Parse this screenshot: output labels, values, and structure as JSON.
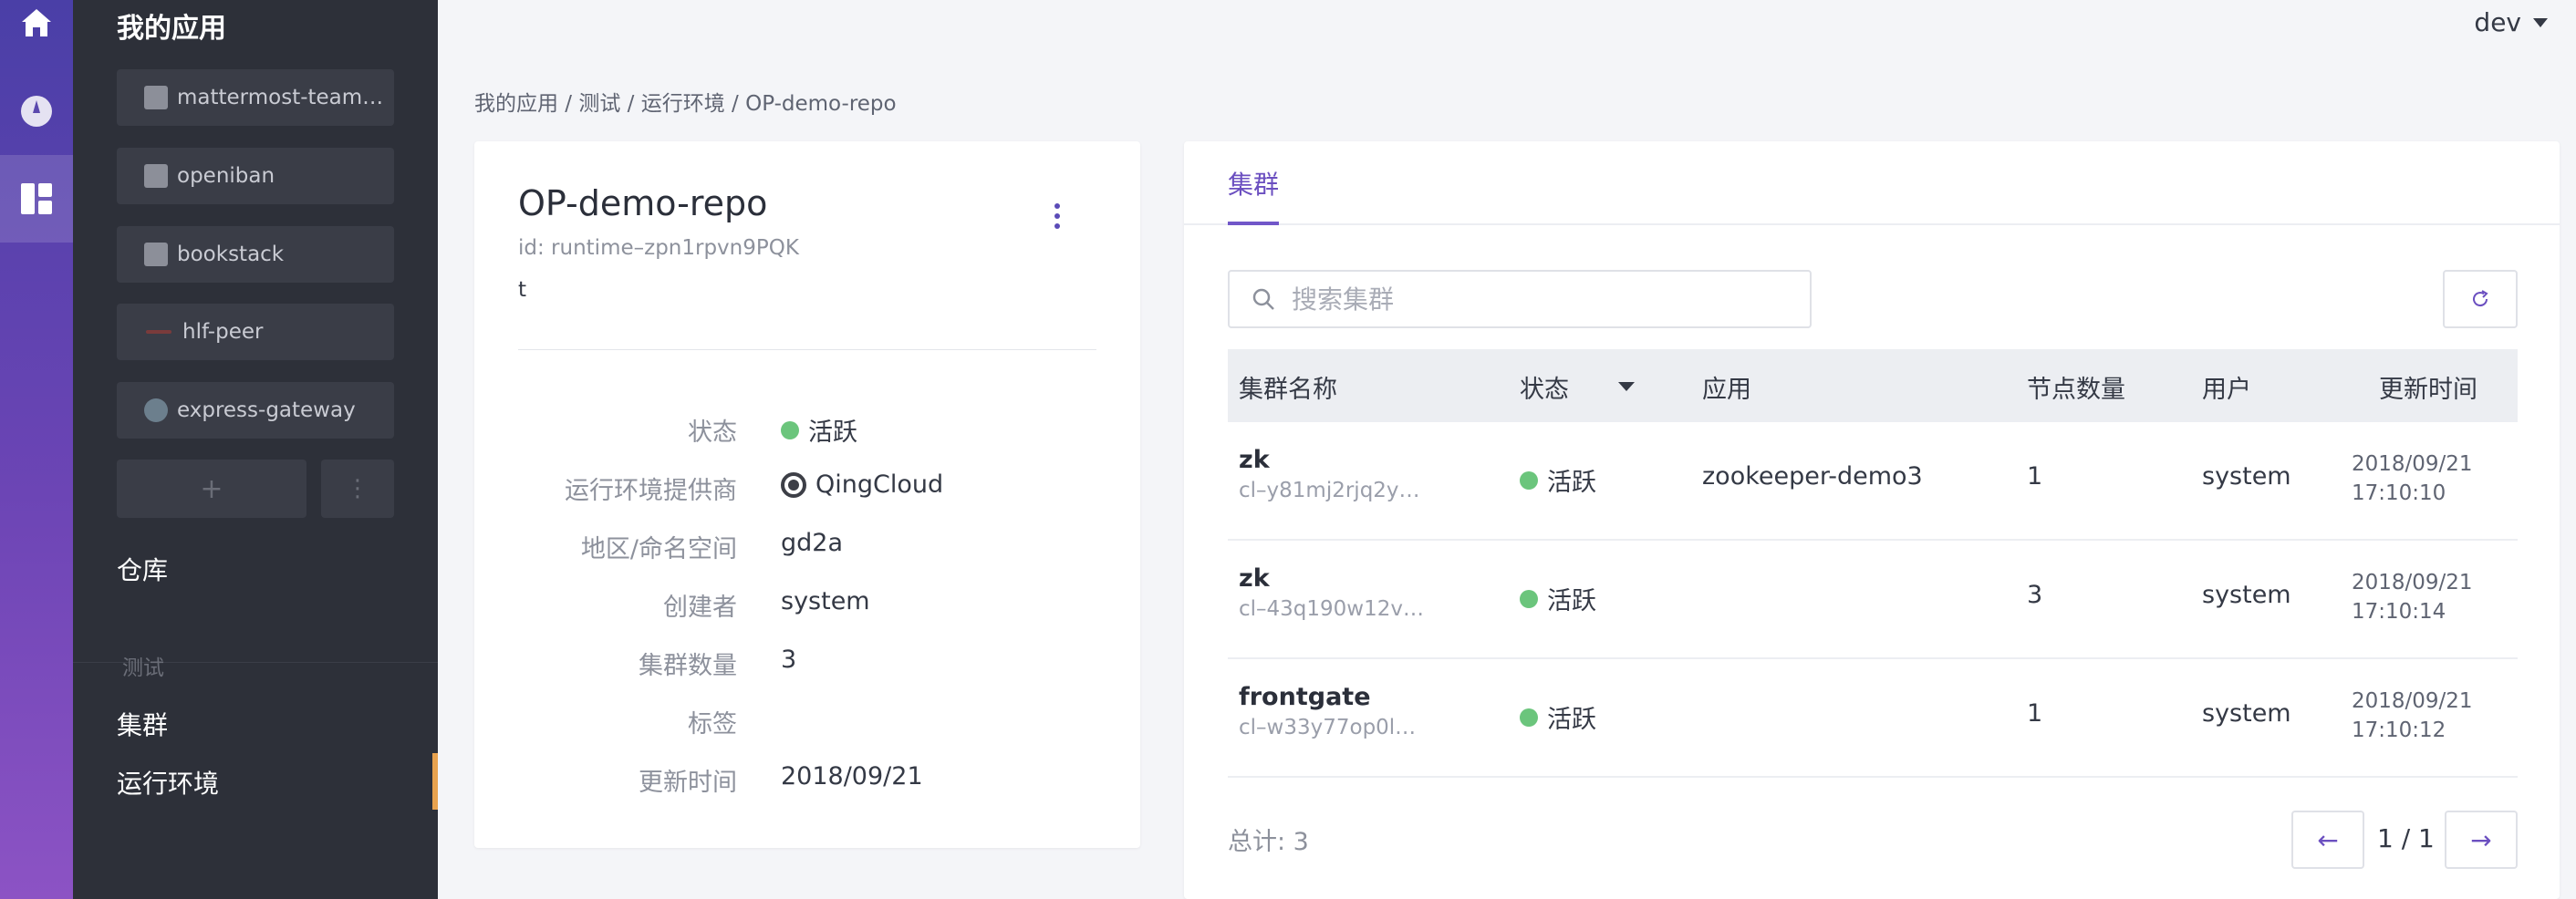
{
  "rail": {
    "items": [
      {
        "icon": "home-icon"
      },
      {
        "icon": "compass-icon"
      },
      {
        "icon": "dashboard-icon",
        "active": true
      }
    ]
  },
  "sidebar": {
    "title": "我的应用",
    "apps": [
      {
        "label": "mattermost-team…",
        "icon": "app-icon"
      },
      {
        "label": "openiban",
        "icon": "app-icon"
      },
      {
        "label": "bookstack",
        "icon": "app-icon"
      },
      {
        "label": "hlf-peer",
        "icon": "peer-icon"
      },
      {
        "label": "express-gateway",
        "icon": "gateway-icon"
      }
    ],
    "add_label": "+",
    "more_label": "⋮",
    "repo_label": "仓库",
    "group_label": "测试",
    "cluster_label": "集群",
    "runtime_label": "运行环境"
  },
  "user": {
    "name": "dev"
  },
  "breadcrumb": "我的应用 / 测试 / 运行环境 / OP-demo-repo",
  "runtime": {
    "title": "OP-demo-repo",
    "id": "id: runtime–zpn1rpvn9PQK",
    "description": "t",
    "props": [
      {
        "label": "状态",
        "value": "活跃"
      },
      {
        "label": "运行环境提供商",
        "value": "QingCloud"
      },
      {
        "label": "地区/命名空间",
        "value": "gd2a"
      },
      {
        "label": "创建者",
        "value": "system"
      },
      {
        "label": "集群数量",
        "value": "3"
      },
      {
        "label": "标签",
        "value": ""
      },
      {
        "label": "更新时间",
        "value": "2018/09/21"
      }
    ]
  },
  "clusters": {
    "tab": "集群",
    "search_placeholder": "搜索集群",
    "columns": [
      "集群名称",
      "状态",
      "应用",
      "节点数量",
      "用户",
      "更新时间"
    ],
    "rows": [
      {
        "name": "zk",
        "id": "cl–y81mj2rjq2y…",
        "status": "活跃",
        "app": "zookeeper-demo3",
        "nodes": "1",
        "user": "system",
        "time": "2018/09/21 17:10:10"
      },
      {
        "name": "zk",
        "id": "cl–43q190w12v…",
        "status": "活跃",
        "app": "",
        "nodes": "3",
        "user": "system",
        "time": "2018/09/21 17:10:14"
      },
      {
        "name": "frontgate",
        "id": "cl–w33y77op0l…",
        "status": "活跃",
        "app": "",
        "nodes": "1",
        "user": "system",
        "time": "2018/09/21 17:10:12"
      }
    ],
    "total": "总计: 3",
    "page": "1 / 1",
    "prev": "←",
    "next": "→"
  },
  "colors": {
    "accent": "#6b4fc0",
    "active_status": "#6bc57c",
    "sidebar_bg": "#2d3039"
  }
}
